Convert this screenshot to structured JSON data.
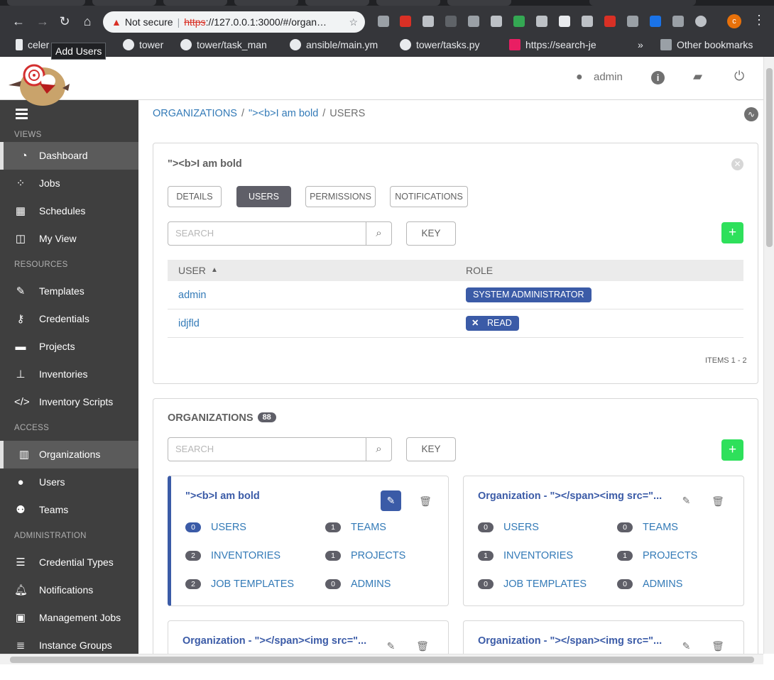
{
  "browser": {
    "not_secure": "Not secure",
    "url_scheme": "https",
    "url_rest": "://127.0.0.1:3000/#/organ…",
    "avatar_letter": "c",
    "bookmarks": [
      "celer",
      "tower",
      "tower/task_man",
      "ansible/main.ym",
      "tower/tasks.py",
      "https://search-je"
    ],
    "other_bookmarks": "Other bookmarks",
    "overflow": "»"
  },
  "tooltip": "Add Users",
  "header": {
    "user": "admin"
  },
  "sidebar": {
    "sections": {
      "views": "VIEWS",
      "resources": "RESOURCES",
      "access": "ACCESS",
      "administration": "ADMINISTRATION"
    },
    "items": [
      {
        "label": "Dashboard",
        "icon": "dashboard-icon"
      },
      {
        "label": "Jobs",
        "icon": "spinner-icon"
      },
      {
        "label": "Schedules",
        "icon": "calendar-icon"
      },
      {
        "label": "My View",
        "icon": "columns-icon"
      },
      {
        "label": "Templates",
        "icon": "edit-icon"
      },
      {
        "label": "Credentials",
        "icon": "key-icon"
      },
      {
        "label": "Projects",
        "icon": "folder-icon"
      },
      {
        "label": "Inventories",
        "icon": "sitemap-icon"
      },
      {
        "label": "Inventory Scripts",
        "icon": "code-icon"
      },
      {
        "label": "Organizations",
        "icon": "building-icon"
      },
      {
        "label": "Users",
        "icon": "user-icon"
      },
      {
        "label": "Teams",
        "icon": "users-icon"
      },
      {
        "label": "Credential Types",
        "icon": "list-icon"
      },
      {
        "label": "Notifications",
        "icon": "bell-icon"
      },
      {
        "label": "Management Jobs",
        "icon": "briefcase-icon"
      },
      {
        "label": "Instance Groups",
        "icon": "server-icon"
      }
    ]
  },
  "breadcrumb": {
    "organizations": "ORGANIZATIONS",
    "org": "\"><b>I am bold",
    "users": "USERS"
  },
  "detail": {
    "title": "\"><b>I am bold",
    "tabs": [
      "DETAILS",
      "USERS",
      "PERMISSIONS",
      "NOTIFICATIONS"
    ],
    "search_placeholder": "SEARCH",
    "key": "KEY",
    "add": "+",
    "columns": {
      "user": "USER",
      "role": "ROLE"
    },
    "rows": [
      {
        "user": "admin",
        "role": "SYSTEM ADMINISTRATOR"
      },
      {
        "user": "idjfld",
        "role": "READ"
      }
    ],
    "items": "ITEMS  1 - 2"
  },
  "organizations": {
    "title": "ORGANIZATIONS",
    "count": "88",
    "search_placeholder": "SEARCH",
    "key": "KEY",
    "add": "+",
    "cards": [
      {
        "title": "\"><b>I am bold",
        "users": "0",
        "teams": "1",
        "inventories": "2",
        "projects": "1",
        "job_templates": "2",
        "admins": "0"
      },
      {
        "title": "Organization - \"></span><img src=\"...",
        "users": "0",
        "teams": "0",
        "inventories": "1",
        "projects": "1",
        "job_templates": "0",
        "admins": "0"
      },
      {
        "title": "Organization - \"></span><img src=\"..."
      },
      {
        "title": "Organization - \"></span><img src=\"..."
      }
    ],
    "labels": {
      "users": "USERS",
      "teams": "TEAMS",
      "inventories": "INVENTORIES",
      "projects": "PROJECTS",
      "job_templates": "JOB TEMPLATES",
      "admins": "ADMINS"
    }
  }
}
